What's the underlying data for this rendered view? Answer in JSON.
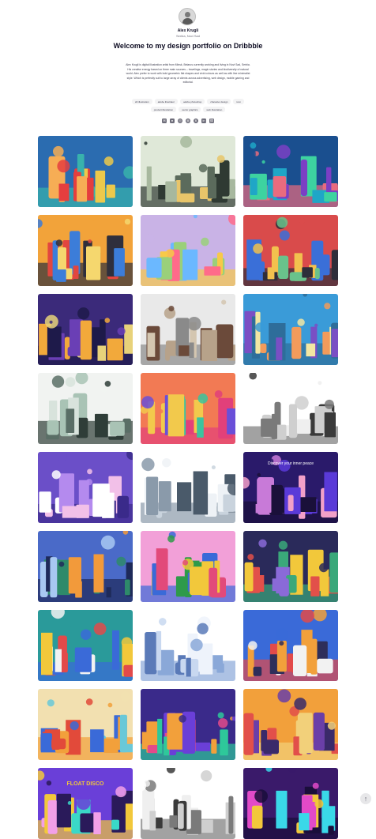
{
  "profile": {
    "name": "Alex Krugli",
    "location": "Serbia, Novi Sad",
    "headline": "Welcome to my design portfolio on Dribbble",
    "bio": "Alex Krugli is digital illustration artist from Minsk, Belarus currently working and living in Novi Sad, Serbia. His creative energy based on three main sources – travelings, magic stories and biodiversity of natural world. Alex prefer to work with bold geometric flat shapes and vivid colours as well as with line minimalist style. Which is perfectly suit to large array of clients across advertising, web design, mobile gaming and editorial.",
    "tags": [
      "2d illustration",
      "adobe illustrator",
      "adobe photoshop",
      "character design",
      "icon",
      "product illustration",
      "vector graphics",
      "web illustration"
    ],
    "social_icons": [
      "email-icon",
      "dribbble-square-icon",
      "instagram-icon",
      "dribbble-icon",
      "behance-icon",
      "linkedin-icon",
      "link-icon"
    ]
  },
  "shots": [
    {
      "name": "shot-city-colorful",
      "palette": [
        "#2b6cb0",
        "#f6ad55",
        "#e53e3e",
        "#38b2ac",
        "#ecc94b"
      ]
    },
    {
      "name": "shot-retro-tech",
      "palette": [
        "#dfe8d8",
        "#5b6b5c",
        "#e8c56a",
        "#2f3a33",
        "#a7b89e"
      ]
    },
    {
      "name": "shot-underwater",
      "palette": [
        "#1a4f8f",
        "#1fa6c7",
        "#7b3fc4",
        "#e96b7e",
        "#3dd3a0"
      ]
    },
    {
      "name": "shot-music-instruments",
      "palette": [
        "#f2a33a",
        "#e2463f",
        "#3c7dd9",
        "#2f2f3c",
        "#f5d76e"
      ]
    },
    {
      "name": "shot-magic-door",
      "palette": [
        "#c9b3e6",
        "#ff6b8a",
        "#6bb8ff",
        "#f7c948",
        "#9ad07a"
      ]
    },
    {
      "name": "shot-retro-room",
      "palette": [
        "#d94b4b",
        "#3a6fd8",
        "#f2c14e",
        "#2e2e3a",
        "#69c28b"
      ]
    },
    {
      "name": "shot-night-cabin",
      "palette": [
        "#3b2a7a",
        "#6a3fb5",
        "#f2a93b",
        "#1e1a4a",
        "#e8d27a"
      ]
    },
    {
      "name": "shot-ornate-gate",
      "palette": [
        "#e9e9e9",
        "#6b4a3a",
        "#b7a28a",
        "#8a8a8a",
        "#d4c6b0"
      ]
    },
    {
      "name": "shot-river-town",
      "palette": [
        "#3a9bd8",
        "#7a4fc4",
        "#f29b5b",
        "#2e6d9a",
        "#f2e6a3"
      ]
    },
    {
      "name": "shot-line-castle",
      "palette": [
        "#f1f3f1",
        "#5a6e66",
        "#a9c3b5",
        "#2f3d38",
        "#d8e3dc"
      ]
    },
    {
      "name": "shot-lanterns",
      "palette": [
        "#f27a54",
        "#3bc49e",
        "#f2c94c",
        "#e2407a",
        "#6a4fd8"
      ]
    },
    {
      "name": "shot-line-harbor",
      "palette": [
        "#ffffff",
        "#3a3a3a",
        "#cfcfcf",
        "#7a7a7a",
        "#efefef"
      ]
    },
    {
      "name": "shot-purple-castle",
      "palette": [
        "#6b4fc8",
        "#f2c0e8",
        "#ffffff",
        "#3a2a8a",
        "#b48aee"
      ]
    },
    {
      "name": "shot-line-map",
      "palette": [
        "#ffffff",
        "#4a5a6a",
        "#c9d3dd",
        "#8a9aaa",
        "#eef2f6"
      ]
    },
    {
      "name": "shot-discover-inner-peace",
      "palette": [
        "#2a1a6a",
        "#5a3ad8",
        "#c87ad8",
        "#1a103a",
        "#f2a0c8"
      ]
    },
    {
      "name": "shot-lake-house",
      "palette": [
        "#4a6ac8",
        "#2e8a6a",
        "#f29a3b",
        "#1e2a5a",
        "#a8c8f2"
      ]
    },
    {
      "name": "shot-beetle",
      "palette": [
        "#f2a0d8",
        "#2e9a4a",
        "#f2c83b",
        "#3a6ad8",
        "#e24a7a"
      ]
    },
    {
      "name": "shot-night-street",
      "palette": [
        "#2a2a5a",
        "#f2c83b",
        "#e2504a",
        "#3aa87a",
        "#8a6ad8"
      ]
    },
    {
      "name": "shot-stamp",
      "palette": [
        "#2a9a9a",
        "#f2f2f2",
        "#e24a4a",
        "#3a6ad8",
        "#f2c83b"
      ]
    },
    {
      "name": "shot-blue-sketches",
      "palette": [
        "#ffffff",
        "#5a7ab8",
        "#c8d8f0",
        "#8aa8d8",
        "#eef3fb"
      ]
    },
    {
      "name": "shot-poster-frame",
      "palette": [
        "#3a6ad8",
        "#f2f2f2",
        "#f2a03b",
        "#e24a4a",
        "#2e2e5a"
      ]
    },
    {
      "name": "shot-tram-street",
      "palette": [
        "#f2e0b0",
        "#e24a3a",
        "#3a6ad8",
        "#f2a03b",
        "#6ac8d8"
      ]
    },
    {
      "name": "shot-deep-sea-diver",
      "palette": [
        "#3a2a8a",
        "#6a3fd8",
        "#f2a03b",
        "#2ec89a",
        "#e24a8a"
      ]
    },
    {
      "name": "shot-village-sunset",
      "palette": [
        "#f2a03b",
        "#6a3fa8",
        "#e2504a",
        "#f2d07a",
        "#3a2a6a"
      ]
    },
    {
      "name": "shot-float-disco",
      "palette": [
        "#6a3fd8",
        "#f2a0e8",
        "#2a1a5a",
        "#f2c83b",
        "#3ad8c8"
      ]
    },
    {
      "name": "shot-line-city-2",
      "palette": [
        "#ffffff",
        "#3a3a3a",
        "#cfcfcf",
        "#7a7a7a",
        "#efefef"
      ]
    },
    {
      "name": "shot-neon-house",
      "palette": [
        "#3a1a6a",
        "#e24ac8",
        "#3ad8e8",
        "#1a0e3a",
        "#f2c83b"
      ]
    }
  ],
  "shot_texts": {
    "discover": "Discover your inner peace",
    "float_disco": "FLOAT DISCO"
  },
  "back_to_top": "↑"
}
